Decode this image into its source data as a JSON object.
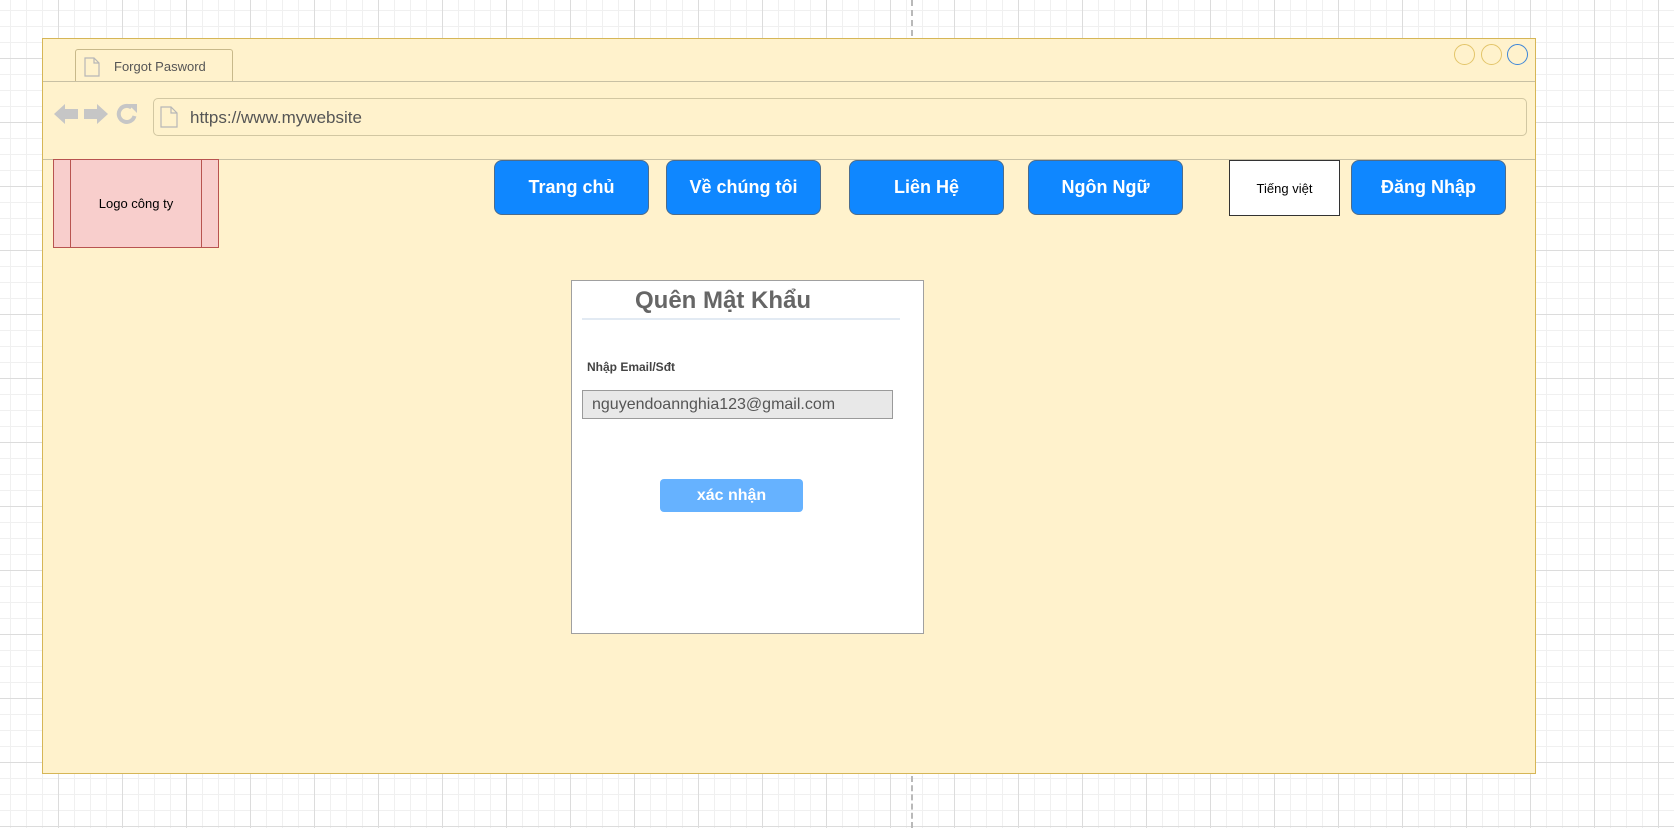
{
  "browser": {
    "tab_title": "Forgot Pasword",
    "url": "https://www.mywebsite",
    "colors": {
      "window_bg": "#fff2cc",
      "window_border": "#d6b656",
      "close_button": "#3d86d8"
    }
  },
  "header": {
    "logo_text": "Logo công ty",
    "nav": [
      {
        "label": "Trang chủ"
      },
      {
        "label": "Về chúng tôi"
      },
      {
        "label": "Liên Hệ"
      },
      {
        "label": "Ngôn Ngữ"
      }
    ],
    "language_value": "Tiếng việt",
    "login_label": "Đăng Nhập",
    "colors": {
      "nav_button": "#0f87ff",
      "logo_bg": "#f8cecc"
    }
  },
  "form": {
    "title": "Quên Mật Khẩu",
    "email_label": "Nhập Email/Sđt",
    "email_value": "nguyendoannghia123@gmail.com",
    "submit_label": "xác nhận",
    "colors": {
      "submit_button": "#66b2ff"
    }
  }
}
